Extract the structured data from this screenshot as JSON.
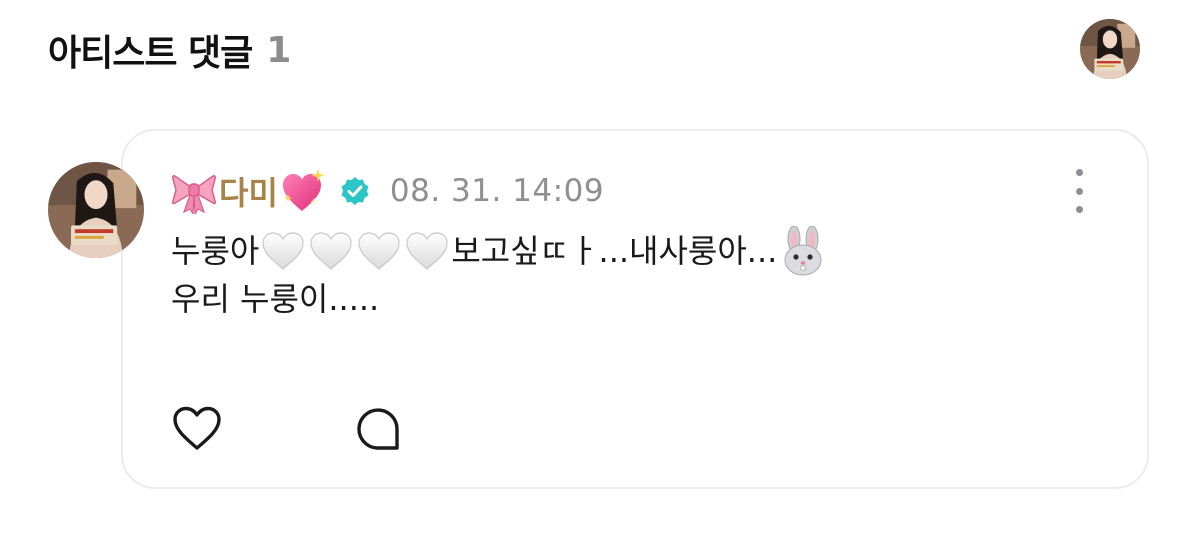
{
  "header": {
    "title": "아티스트 댓글",
    "count": "1"
  },
  "comment": {
    "author_name": "다미",
    "author_prefix_icon": "ribbon-icon",
    "author_suffix_icon": "sparkling-heart-icon",
    "verified_icon": "verified-badge-icon",
    "timestamp": "08. 31. 14:09",
    "lines": [
      {
        "segments": [
          "누룽아",
          "보고싶ㄸㅏ...내사룽아...",
          "우리 누룽이....."
        ]
      }
    ],
    "text_1a": "누룽아",
    "text_1b": "보고싶ㄸㅏ...내사룽아...",
    "text_2": "우리 누룽이.....",
    "inline_icons": [
      "white-heart-icon",
      "white-heart-icon",
      "white-heart-icon",
      "white-heart-icon",
      "rabbit-face-icon"
    ]
  },
  "actions": {
    "like_icon": "heart-outline-icon",
    "reply_icon": "comment-bubble-icon",
    "more_icon": "more-vertical-icon"
  },
  "colors": {
    "author": "#a8844a",
    "timestamp": "#8e8e93",
    "card_border": "#ebebf0",
    "verified": "#2cc6c6",
    "count": "#8c8c8c"
  }
}
